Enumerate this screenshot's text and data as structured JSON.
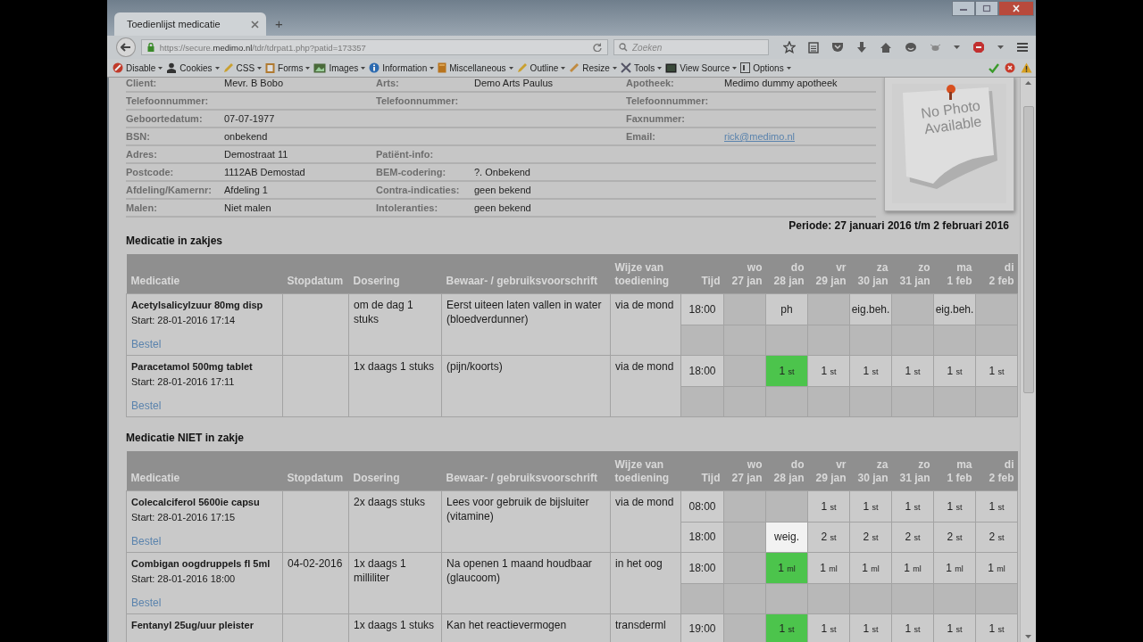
{
  "window": {
    "tab_title": "Toedienlijst medicatie",
    "new_tab": "+"
  },
  "navigation": {
    "url_prefix": "https://secure.",
    "url_domain": "medimo.nl",
    "url_path": "/tdr/tdrpat1.php?patid=173357",
    "search_placeholder": "Zoeken"
  },
  "dev_toolbar": [
    {
      "label": "Disable",
      "kind": "disable"
    },
    {
      "label": "Cookies",
      "kind": "cookies"
    },
    {
      "label": "CSS",
      "kind": "css"
    },
    {
      "label": "Forms",
      "kind": "forms"
    },
    {
      "label": "Images",
      "kind": "images"
    },
    {
      "label": "Information",
      "kind": "information"
    },
    {
      "label": "Miscellaneous",
      "kind": "misc"
    },
    {
      "label": "Outline",
      "kind": "outline"
    },
    {
      "label": "Resize",
      "kind": "resize"
    },
    {
      "label": "Tools",
      "kind": "tools"
    },
    {
      "label": "View Source",
      "kind": "source"
    },
    {
      "label": "Options",
      "kind": "options"
    }
  ],
  "patient_info": [
    {
      "left": {
        "label": "Client:",
        "value": "Mevr. B Bobo"
      },
      "middle": {
        "label": "Arts:",
        "value": "Demo Arts Paulus"
      },
      "right": {
        "label": "Apotheek:",
        "value": "Medimo dummy apotheek"
      }
    },
    {
      "left": {
        "label": "Telefoonnummer:"
      },
      "middle": {
        "label": "Telefoonnummer:"
      },
      "right": {
        "label": "Telefoonnummer:"
      }
    },
    {
      "left": {
        "label": "Geboortedatum:",
        "value": "07-07-1977"
      },
      "right": {
        "label": "Faxnummer:"
      }
    },
    {
      "left": {
        "label": "BSN:",
        "value": "onbekend"
      },
      "right": {
        "label": "Email:",
        "value": "rick@medimo.nl",
        "kind": "link"
      }
    },
    {
      "left": {
        "label": "Adres:",
        "value": "Demostraat 11"
      },
      "middle": {
        "label": "Patiënt-info:"
      }
    },
    {
      "left": {
        "label": "Postcode:",
        "value": "1112AB Demostad"
      },
      "middle": {
        "label": "BEM-codering:",
        "value": "?. Onbekend"
      }
    },
    {
      "left": {
        "label": "Afdeling/Kamernr:",
        "value": "Afdeling 1"
      },
      "middle": {
        "label": "Contra-indicaties:",
        "value": "geen bekend"
      }
    },
    {
      "left": {
        "label": "Malen:",
        "value": "Niet malen"
      },
      "middle": {
        "label": "Intoleranties:",
        "value": "geen bekend"
      }
    }
  ],
  "photo": {
    "text": "No Photo Available"
  },
  "period": "Periode: 27 januari 2016 t/m 2 februari 2016",
  "sections": [
    {
      "title": "Medicatie in zakjes",
      "columns": [
        "Medicatie",
        "Stopdatum",
        "Dosering",
        "Bewaar- / gebruiksvoorschrift",
        "Wijze van toediening",
        "Tijd"
      ],
      "days": [
        {
          "weekday": "wo",
          "date": "27 jan"
        },
        {
          "weekday": "do",
          "date": "28 jan"
        },
        {
          "weekday": "vr",
          "date": "29 jan"
        },
        {
          "weekday": "za",
          "date": "30 jan"
        },
        {
          "weekday": "zo",
          "date": "31 jan"
        },
        {
          "weekday": "ma",
          "date": "1 feb"
        },
        {
          "weekday": "di",
          "date": "2 feb"
        }
      ],
      "rows": [
        {
          "name": "Acetylsalicylzuur 80mg disp",
          "start": "Start: 28-01-2016 17:14",
          "order": "Bestel",
          "dosing": "om de dag 1 stuks",
          "instructions": "Eerst uiteen laten vallen in water (bloedverdunner)",
          "route": "via de mond",
          "slots": [
            {
              "time": "18:00",
              "doses": [
                {
                  "given": false,
                  "refused": false
                },
                {
                  "text": "ph",
                  "given": false,
                  "refused": false
                },
                {
                  "given": false,
                  "refused": false
                },
                {
                  "text": "eig.beh.",
                  "given": false,
                  "refused": false
                },
                {
                  "given": false,
                  "refused": false
                },
                {
                  "text": "eig.beh.",
                  "given": false,
                  "refused": false
                },
                {
                  "given": false,
                  "refused": false
                }
              ]
            }
          ]
        },
        {
          "name": "Paracetamol 500mg tablet",
          "start": "Start: 28-01-2016 17:11",
          "order": "Bestel",
          "dosing": "1x daags 1 stuks",
          "instructions": "(pijn/koorts)",
          "route": "via de mond",
          "slots": [
            {
              "time": "18:00",
              "doses": [
                {
                  "given": false,
                  "refused": false
                },
                {
                  "amount": "1",
                  "unit": "st",
                  "given": true,
                  "refused": false
                },
                {
                  "amount": "1",
                  "unit": "st",
                  "given": false,
                  "refused": false
                },
                {
                  "amount": "1",
                  "unit": "st",
                  "given": false,
                  "refused": false
                },
                {
                  "amount": "1",
                  "unit": "st",
                  "given": false,
                  "refused": false
                },
                {
                  "amount": "1",
                  "unit": "st",
                  "given": false,
                  "refused": false
                },
                {
                  "amount": "1",
                  "unit": "st",
                  "given": false,
                  "refused": false
                }
              ]
            }
          ]
        }
      ]
    },
    {
      "title": "Medicatie NIET in zakje",
      "columns": [
        "Medicatie",
        "Stopdatum",
        "Dosering",
        "Bewaar- / gebruiksvoorschrift",
        "Wijze van toediening",
        "Tijd"
      ],
      "days": [
        {
          "weekday": "wo",
          "date": "27 jan"
        },
        {
          "weekday": "do",
          "date": "28 jan"
        },
        {
          "weekday": "vr",
          "date": "29 jan"
        },
        {
          "weekday": "za",
          "date": "30 jan"
        },
        {
          "weekday": "zo",
          "date": "31 jan"
        },
        {
          "weekday": "ma",
          "date": "1 feb"
        },
        {
          "weekday": "di",
          "date": "2 feb"
        }
      ],
      "rows": [
        {
          "name": "Colecalciferol 5600ie capsu",
          "start": "Start: 28-01-2016 17:15",
          "order": "Bestel",
          "dosing": "2x daags stuks",
          "instructions": "Lees voor gebruik de bijsluiter (vitamine)",
          "route": "via de mond",
          "slots": [
            {
              "time": "08:00",
              "doses": [
                {
                  "given": false,
                  "refused": false
                },
                {
                  "given": false,
                  "refused": false
                },
                {
                  "amount": "1",
                  "unit": "st",
                  "given": false,
                  "refused": false
                },
                {
                  "amount": "1",
                  "unit": "st",
                  "given": false,
                  "refused": false
                },
                {
                  "amount": "1",
                  "unit": "st",
                  "given": false,
                  "refused": false
                },
                {
                  "amount": "1",
                  "unit": "st",
                  "given": false,
                  "refused": false
                },
                {
                  "amount": "1",
                  "unit": "st",
                  "given": false,
                  "refused": false
                }
              ]
            },
            {
              "time": "18:00",
              "doses": [
                {
                  "given": false,
                  "refused": false
                },
                {
                  "text": "weig.",
                  "given": false,
                  "refused": true
                },
                {
                  "amount": "2",
                  "unit": "st",
                  "given": false,
                  "refused": false
                },
                {
                  "amount": "2",
                  "unit": "st",
                  "given": false,
                  "refused": false
                },
                {
                  "amount": "2",
                  "unit": "st",
                  "given": false,
                  "refused": false
                },
                {
                  "amount": "2",
                  "unit": "st",
                  "given": false,
                  "refused": false
                },
                {
                  "amount": "2",
                  "unit": "st",
                  "given": false,
                  "refused": false
                }
              ]
            }
          ]
        },
        {
          "name": "Combigan oogdruppels fl 5ml",
          "start": "Start: 28-01-2016 18:00",
          "order": "Bestel",
          "stop_date": "04-02-2016",
          "dosing": "1x daags 1 milliliter",
          "instructions": "Na openen 1 maand houdbaar (glaucoom)",
          "route": "in het oog",
          "slots": [
            {
              "time": "18:00",
              "doses": [
                {
                  "given": false,
                  "refused": false
                },
                {
                  "amount": "1",
                  "unit": "ml",
                  "given": true,
                  "refused": false
                },
                {
                  "amount": "1",
                  "unit": "ml",
                  "given": false,
                  "refused": false
                },
                {
                  "amount": "1",
                  "unit": "ml",
                  "given": false,
                  "refused": false
                },
                {
                  "amount": "1",
                  "unit": "ml",
                  "given": false,
                  "refused": false
                },
                {
                  "amount": "1",
                  "unit": "ml",
                  "given": false,
                  "refused": false
                },
                {
                  "amount": "1",
                  "unit": "ml",
                  "given": false,
                  "refused": false
                }
              ]
            }
          ]
        },
        {
          "name": "Fentanyl 25ug/uur pleister",
          "dosing": "1x daags 1 stuks",
          "instructions": "Kan het reactievermogen",
          "route": "transderml",
          "slots": [
            {
              "time": "19:00",
              "doses": [
                {
                  "given": false,
                  "refused": false
                },
                {
                  "amount": "1",
                  "unit": "st",
                  "given": true,
                  "refused": false
                },
                {
                  "amount": "1",
                  "unit": "st",
                  "given": false,
                  "refused": false
                },
                {
                  "amount": "1",
                  "unit": "st",
                  "given": false,
                  "refused": false
                },
                {
                  "amount": "1",
                  "unit": "st",
                  "given": false,
                  "refused": false
                },
                {
                  "amount": "1",
                  "unit": "st",
                  "given": false,
                  "refused": false
                },
                {
                  "amount": "1",
                  "unit": "st",
                  "given": false,
                  "refused": false
                }
              ]
            }
          ]
        }
      ]
    }
  ]
}
